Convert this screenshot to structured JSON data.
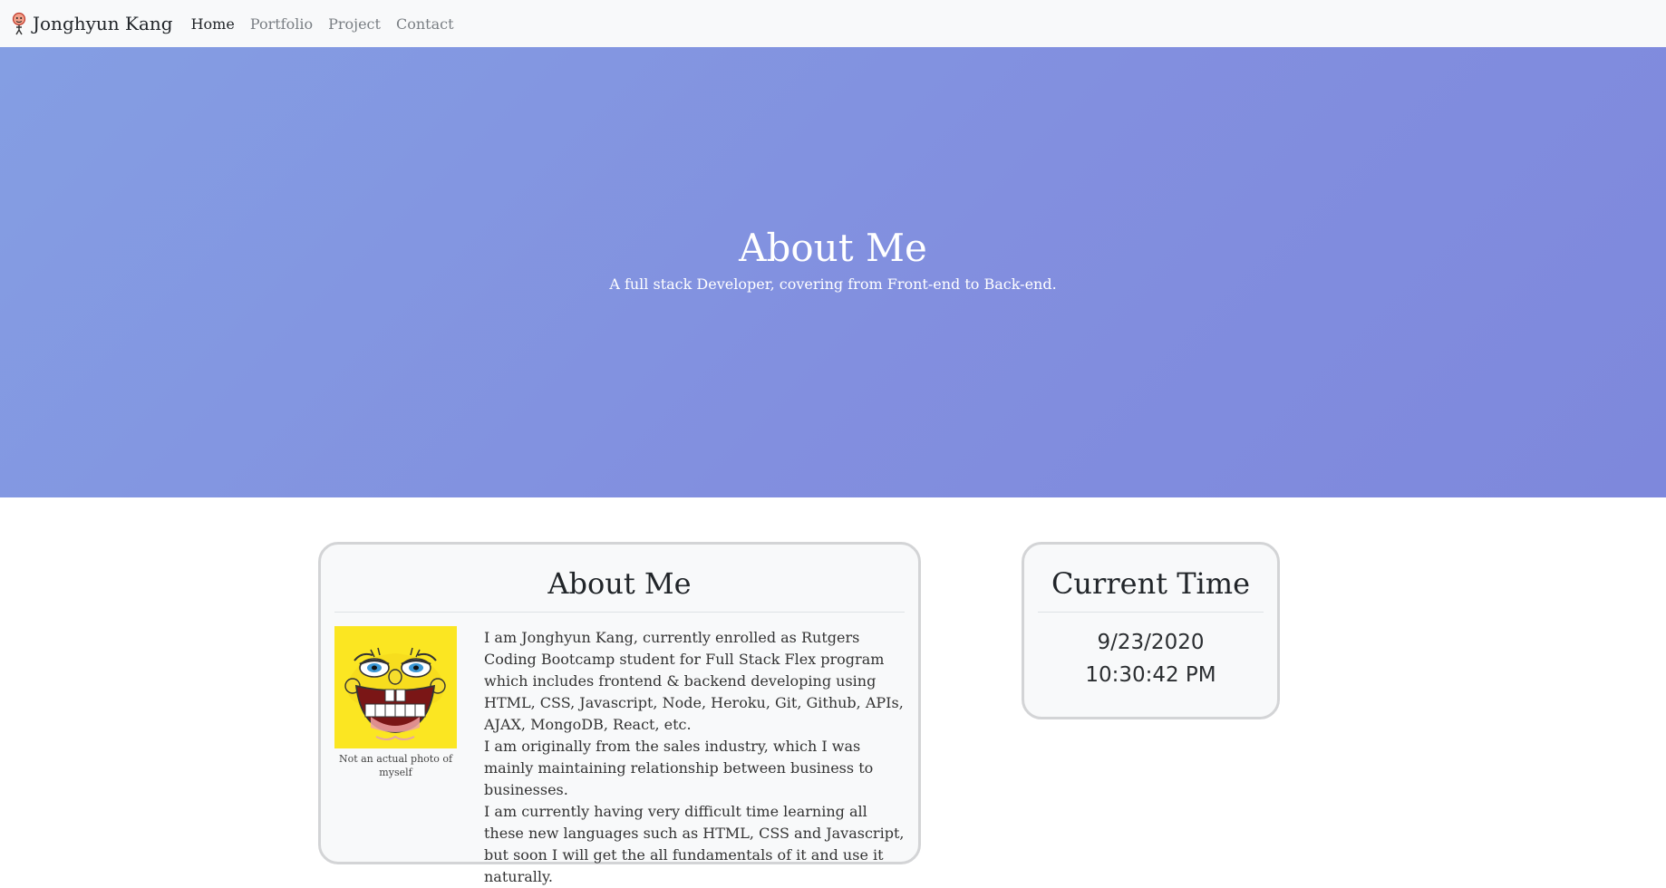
{
  "navbar": {
    "brand": "Jonghyun Kang",
    "brand_icon": "person-icon",
    "links": [
      {
        "label": "Home",
        "active": true
      },
      {
        "label": "Portfolio",
        "active": false
      },
      {
        "label": "Project",
        "active": false
      },
      {
        "label": "Contact",
        "active": false
      }
    ]
  },
  "hero": {
    "title": "About Me",
    "subtitle": "A full stack Developer, covering from Front-end to Back-end.",
    "gradient_start": "#849ee3",
    "gradient_end": "#7e88dc"
  },
  "about": {
    "title": "About Me",
    "photo_caption": "Not an actual photo of myself",
    "paragraphs": [
      "I am Jonghyun Kang, currently enrolled as Rutgers Coding Bootcamp student for Full Stack Flex program which includes frontend & backend developing using HTML, CSS, Javascript, Node, Heroku, Git, Github, APIs, AJAX, MongoDB, React, etc.",
      "I am originally from the sales industry, which I was mainly maintaining relationship between business to businesses.",
      "I am currently having very difficult time learning all these new languages such as HTML, CSS and Javascript, but soon I will get the all fundamentals of it and use it naturally."
    ]
  },
  "time": {
    "title": "Current Time",
    "date": "9/23/2020",
    "clock": "10:30:42 PM"
  }
}
